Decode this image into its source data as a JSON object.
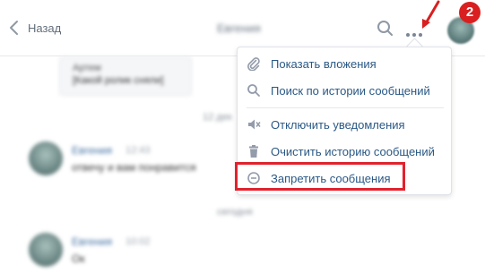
{
  "header": {
    "back_label": "Назад",
    "title": "Евгения",
    "back_icon": "chevron-left-icon",
    "search_icon": "search-icon",
    "more_icon": "more-horizontal-icon"
  },
  "annotation": {
    "badge": "2",
    "color": "#d91f1f"
  },
  "menu": {
    "items": [
      {
        "label": "Показать вложения",
        "icon": "paperclip-icon"
      },
      {
        "label": "Поиск по истории сообщений",
        "icon": "search-icon"
      },
      {
        "label": "Отключить уведомления",
        "icon": "mute-icon"
      },
      {
        "label": "Очистить историю сообщений",
        "icon": "trash-icon"
      },
      {
        "label": "Запретить сообщения",
        "icon": "block-icon"
      }
    ],
    "text_color": "#2a5885",
    "highlight_color": "#e0232e"
  },
  "chat": {
    "bubble_line1": "Артем",
    "bubble_line2": "[Какой ролик сняли]",
    "date1": "12 дек",
    "msg1_name": "Евгения",
    "msg1_time": "12:43",
    "msg1_text": "отвечу и вам понравится",
    "date2": "сегодня",
    "msg2_name": "Евгения",
    "msg2_time": "10:02",
    "msg2_text": "Ок"
  }
}
